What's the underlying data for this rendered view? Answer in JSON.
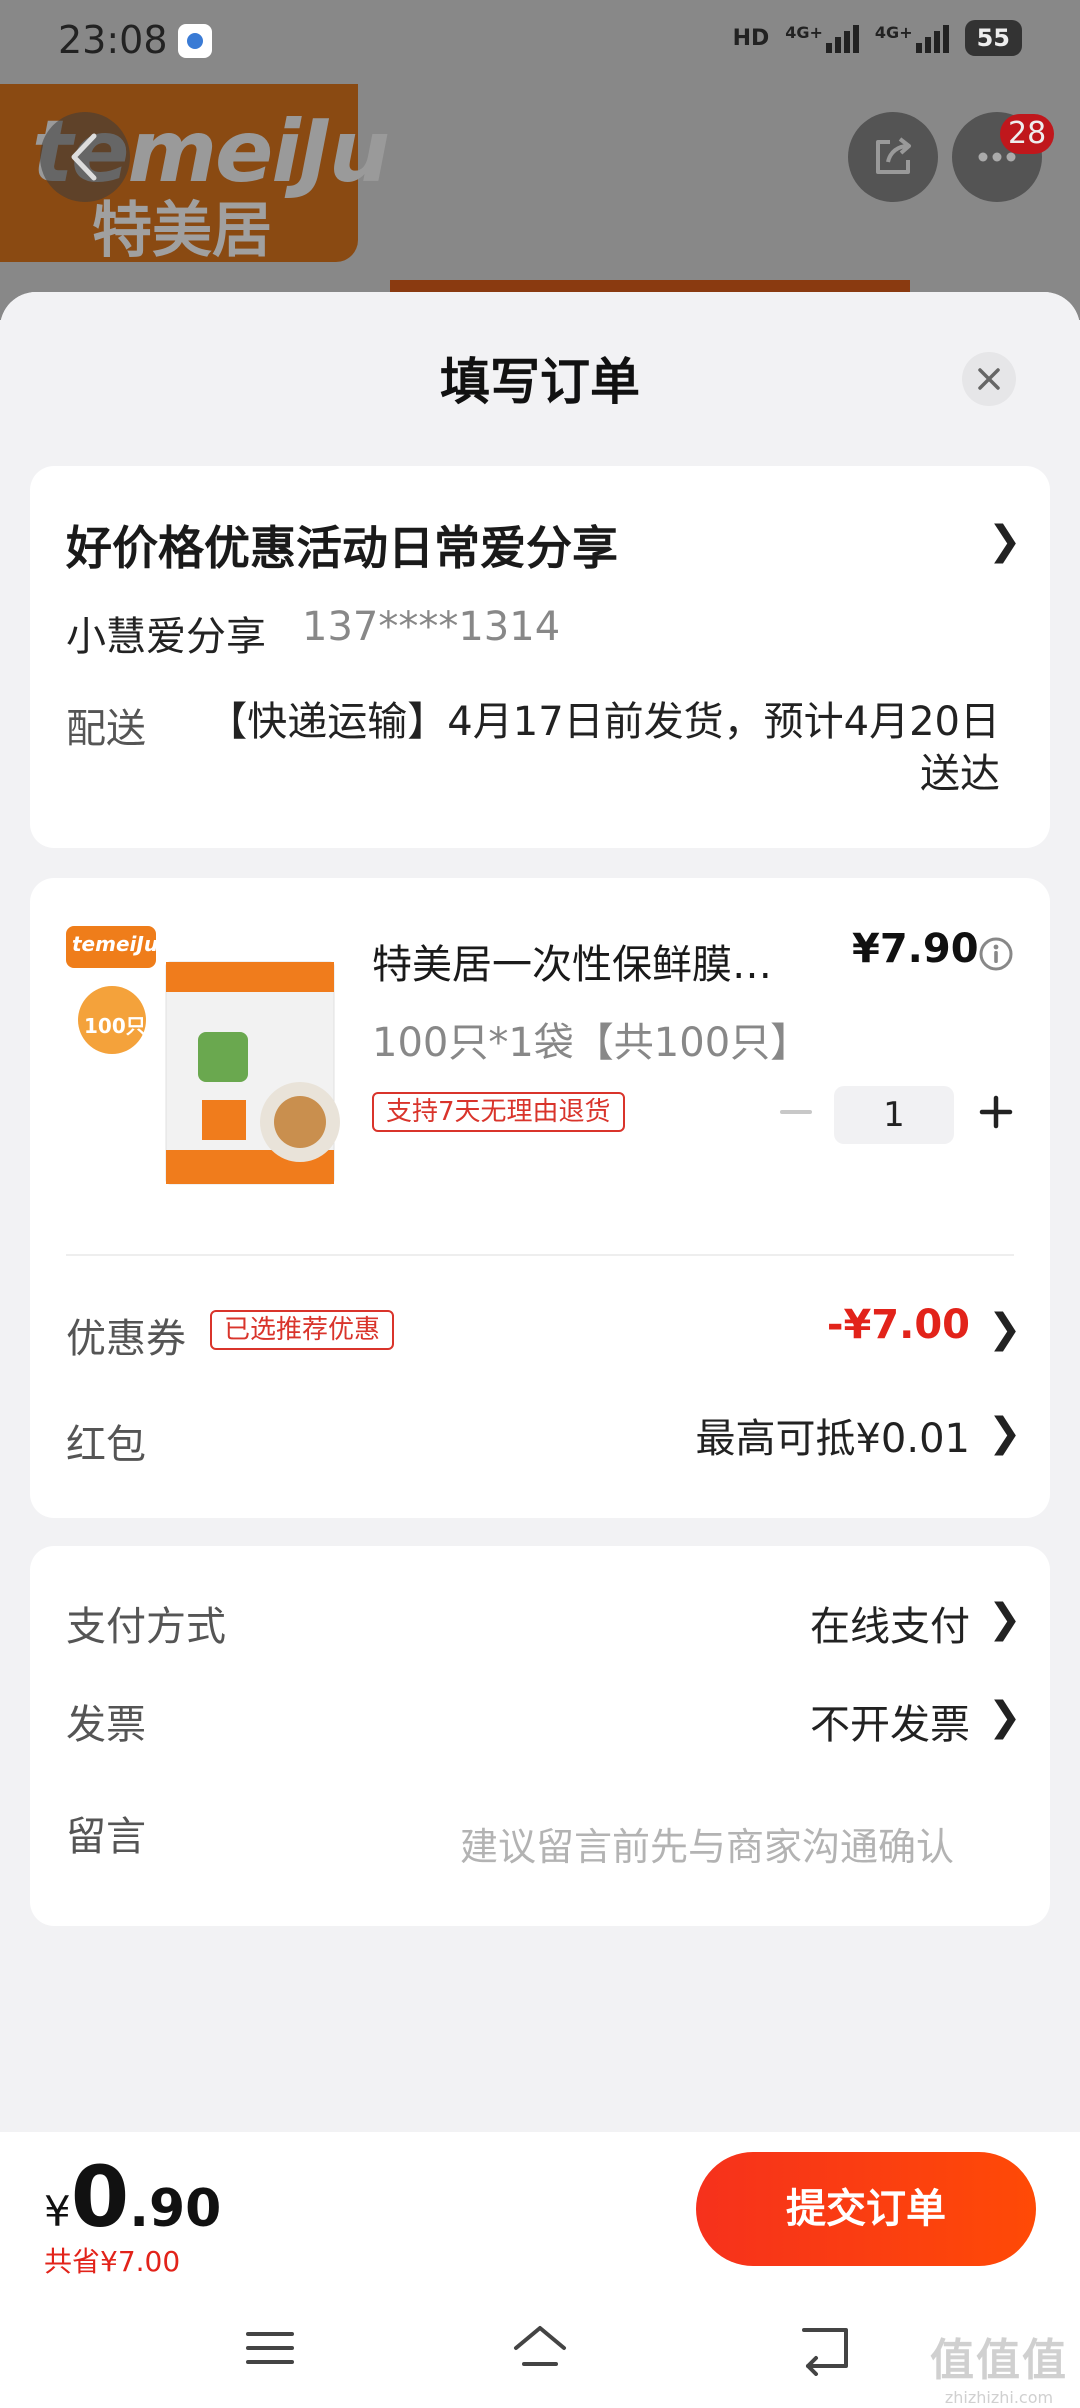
{
  "status_bar": {
    "time": "23:08",
    "network": "HD",
    "sim1": "4G+",
    "sim2": "4G+",
    "battery": "55"
  },
  "background": {
    "brand_en": "temeiJu",
    "brand_cn": "特美居",
    "notification_count": "28"
  },
  "sheet": {
    "title": "填写订单"
  },
  "address": {
    "title": "好价格优惠活动日常爱分享",
    "name": "小慧爱分享",
    "phone": "137****1314",
    "delivery_label": "配送",
    "delivery_text": "【快递运输】4月17日前发货，预计4月20日送达"
  },
  "product": {
    "name": "特美居一次性保鲜膜…",
    "price": "¥7.90",
    "spec": "100只*1袋【共100只】",
    "return_policy": "支持7天无理由退货",
    "quantity": "1",
    "image_brand": "temeiJu",
    "image_badge": "100只"
  },
  "coupon": {
    "label": "优惠券",
    "tag": "已选推荐优惠",
    "value": "-¥7.00"
  },
  "red_packet": {
    "label": "红包",
    "value": "最高可抵¥0.01"
  },
  "payment": {
    "label": "支付方式",
    "value": "在线支付"
  },
  "invoice": {
    "label": "发票",
    "value": "不开发票"
  },
  "remark": {
    "label": "留言",
    "placeholder": "建议留言前先与商家沟通确认"
  },
  "footer": {
    "currency": "¥",
    "total_int": "0",
    "total_dec": ".90",
    "saved": "共省¥7.00",
    "submit": "提交订单"
  },
  "watermark": {
    "text": "值值值",
    "url": "zhizhizhi.com"
  },
  "colors": {
    "accent": "#e2231a",
    "submit_start": "#f6311c",
    "submit_end": "#ff4a06"
  }
}
